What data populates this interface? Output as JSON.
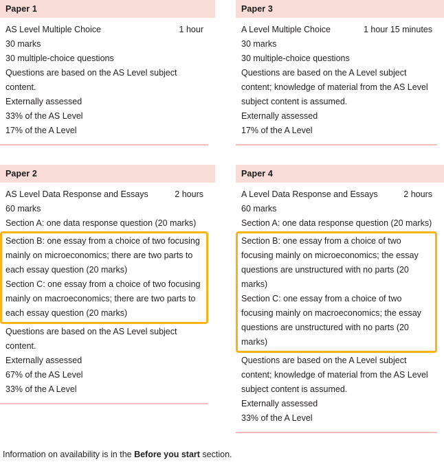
{
  "theme": {
    "header_bg": "#f8dcd8",
    "divider": "#f3bcb8",
    "highlight_border": "#fcb415",
    "text": "#231f20",
    "page_bg": "#ffffff"
  },
  "papers": [
    {
      "id": "paper-1",
      "title": "Paper 1",
      "name": "AS Level Multiple Choice",
      "duration": "1 hour",
      "marks": "30 marks",
      "question_summary": "30 multiple-choice questions",
      "sections": [],
      "highlighted_sections": [],
      "content_note": "Questions are based on the AS Level subject content.",
      "assessment": "Externally assessed",
      "weightings": [
        "33% of the AS Level",
        "17% of the A Level"
      ]
    },
    {
      "id": "paper-3",
      "title": "Paper 3",
      "name": "A Level Multiple Choice",
      "duration": "1 hour 15 minutes",
      "marks": "30 marks",
      "question_summary": "30 multiple-choice questions",
      "sections": [],
      "highlighted_sections": [],
      "content_note": "Questions are based on the A Level subject content; knowledge of material from the AS Level subject content is assumed.",
      "assessment": "Externally assessed",
      "weightings": [
        "17% of the A Level"
      ]
    },
    {
      "id": "paper-2",
      "title": "Paper 2",
      "name": "AS Level Data Response and Essays",
      "duration": "2 hours",
      "marks": "60 marks",
      "question_summary": "",
      "sections": [
        "Section A: one data response question (20 marks)"
      ],
      "highlighted_sections": [
        "Section B: one essay from a choice of two focusing mainly on microeconomics; there are two parts to each essay question (20 marks)",
        "Section C: one essay from a choice of two focusing mainly on macroeconomics; there are two parts to each essay question (20 marks)"
      ],
      "content_note": "Questions are based on the AS Level subject content.",
      "assessment": "Externally assessed",
      "weightings": [
        "67% of the AS Level",
        "33% of the A Level"
      ]
    },
    {
      "id": "paper-4",
      "title": "Paper 4",
      "name": "A Level Data Response and Essays",
      "duration": "2 hours",
      "marks": "60 marks",
      "question_summary": "",
      "sections": [
        "Section A: one data response question (20 marks)"
      ],
      "highlighted_sections": [
        "Section B: one essay from a choice of two focusing mainly on microeconomics; the essay questions are unstructured with no parts (20 marks)",
        "Section C: one essay from a choice of two focusing mainly on macroeconomics; the essay questions are unstructured with no parts (20 marks)"
      ],
      "content_note": "Questions are based on the A Level subject content; knowledge of material from the AS Level subject content is assumed.",
      "assessment": "Externally assessed",
      "weightings": [
        "33% of the A Level"
      ]
    }
  ],
  "footer": {
    "prefix": "Information on availability is in the ",
    "emphasis": "Before you start",
    "suffix": " section."
  }
}
